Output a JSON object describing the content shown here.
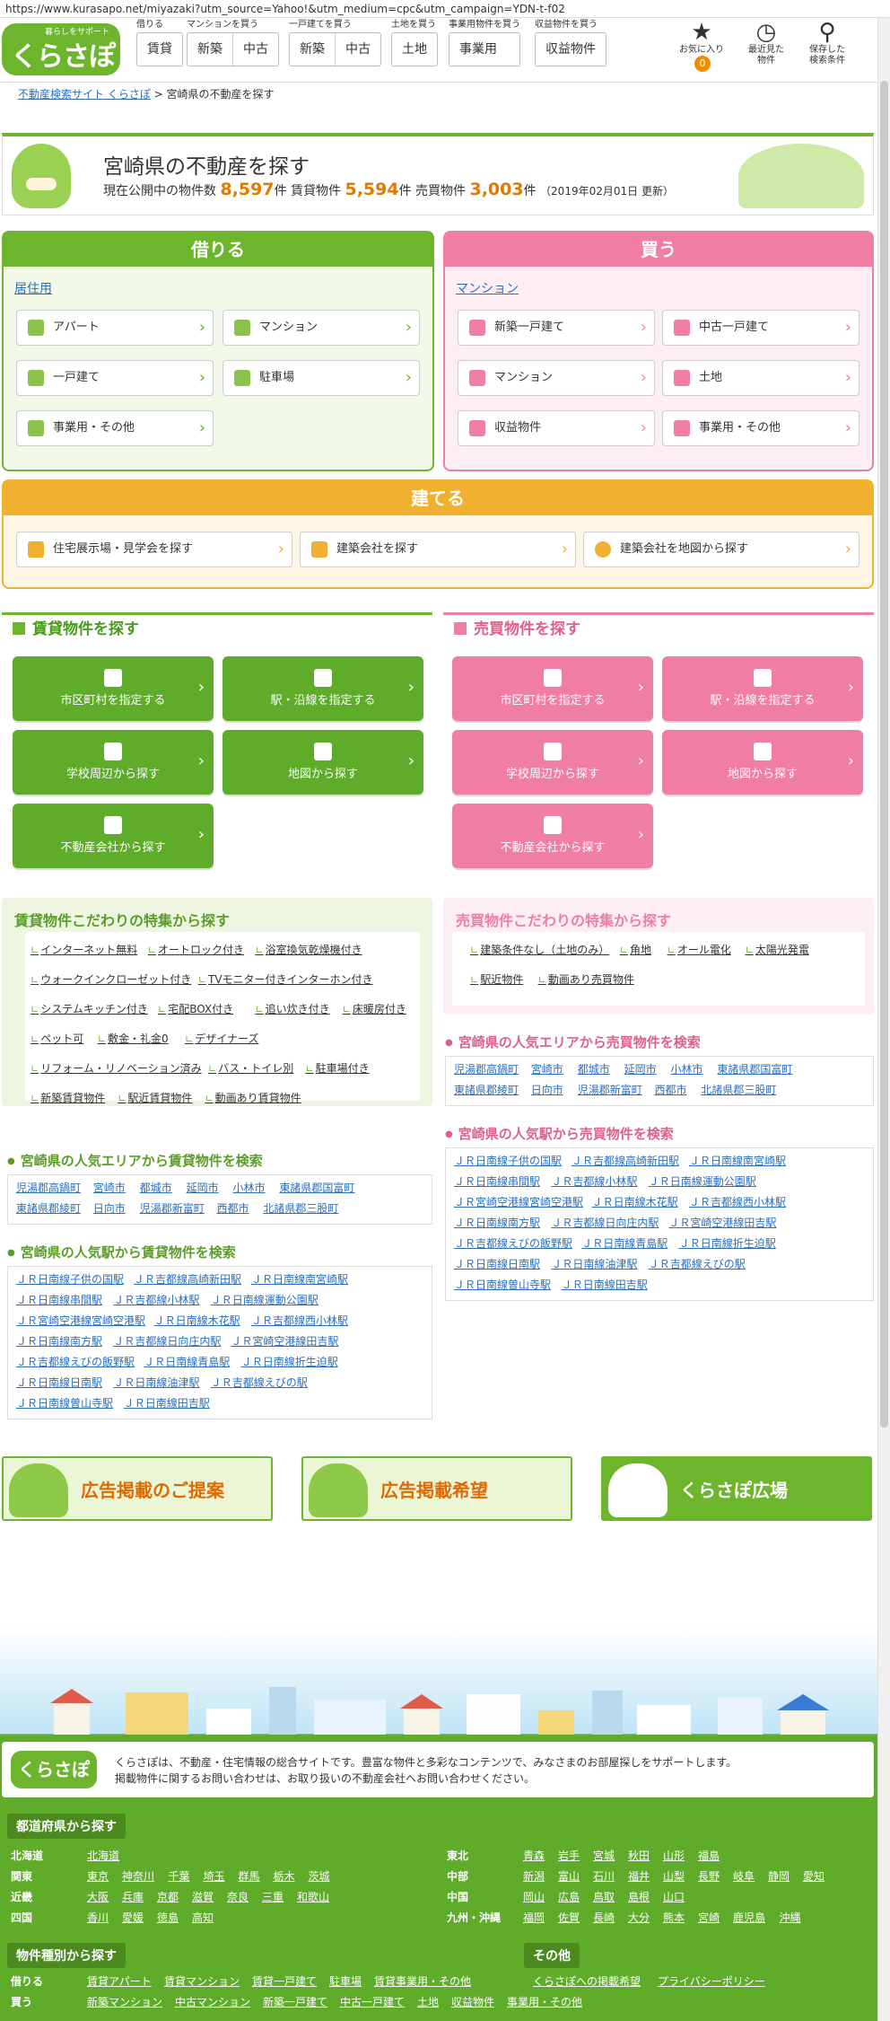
{
  "url": "https://www.kurasapo.net/miyazaki?utm_source=Yahoo!&utm_medium=cpc&utm_campaign=YDN-t-f02",
  "logo": {
    "sub": "暮らしをサポート",
    "main": "くらさぽ"
  },
  "nav": [
    {
      "cap": "借りる",
      "items": [
        "賃貸"
      ]
    },
    {
      "cap": "マンションを買う",
      "items": [
        "新築",
        "中古"
      ]
    },
    {
      "cap": "一戸建てを買う",
      "items": [
        "新築",
        "中古"
      ]
    },
    {
      "cap": "土地を買う",
      "items": [
        "土地"
      ]
    },
    {
      "cap": "事業用物件を買う",
      "items": [
        "事業用"
      ]
    },
    {
      "cap": "収益物件を買う",
      "items": [
        "収益物件"
      ]
    }
  ],
  "hicons": [
    {
      "label": "お気に入り",
      "badge": "0"
    },
    {
      "label": "最近見た\n物件"
    },
    {
      "label": "保存した\n検索条件"
    }
  ],
  "breadcrumb": {
    "home": "不動産検索サイト くらさぽ",
    "sep": ">",
    "current": "宮崎県の不動産を探す"
  },
  "hero": {
    "title": "宮崎県の不動産を探す",
    "l1": "現在公開中の物件数",
    "n1": "8,597",
    "u1": "件 賃貸物件",
    "n2": "5,594",
    "u2": "件 売買物件",
    "n3": "3,003",
    "u3": "件",
    "date": "（2019年02月01日 更新）"
  },
  "rent": {
    "title": "借りる",
    "sub": "居住用",
    "tiles": [
      "アパート",
      "マンション",
      "一戸建て",
      "駐車場",
      "事業用・その他"
    ]
  },
  "buy": {
    "title": "買う",
    "sub": "マンション",
    "tiles": [
      "新築一戸建て",
      "中古一戸建て",
      "マンション",
      "土地",
      "収益物件",
      "事業用・その他"
    ]
  },
  "build": {
    "title": "建てる",
    "tiles": [
      "住宅展示場・見学会を探す",
      "建築会社を探す",
      "建築会社を地図から探す"
    ]
  },
  "rentSearch": {
    "title": "賃貸物件を探す",
    "btns": [
      "市区町村を指定する",
      "駅・沿線を指定する",
      "学校周辺から探す",
      "地図から探す",
      "不動産会社から探す"
    ]
  },
  "buySearch": {
    "title": "売買物件を探す",
    "btns": [
      "市区町村を指定する",
      "駅・沿線を指定する",
      "学校周辺から探す",
      "地図から探す",
      "不動産会社から探す"
    ]
  },
  "rentFeat": {
    "title": "賃貸物件こだわりの特集から探す",
    "tags": [
      [
        "インターネット無料",
        "オートロック付き",
        "浴室換気乾燥機付き"
      ],
      [
        "ウォークインクローゼット付き",
        "TVモニター付きインターホン付き"
      ],
      [
        "システムキッチン付き",
        "宅配BOX付き",
        "追い炊き付き",
        "床暖房付き"
      ],
      [
        "ペット可",
        "敷金・礼金0",
        "デザイナーズ"
      ],
      [
        "リフォーム・リノベーション済み",
        "バス・トイレ別",
        "駐車場付き"
      ],
      [
        "新築賃貸物件",
        "駅近賃貸物件",
        "動画あり賃貸物件"
      ]
    ]
  },
  "buyFeat": {
    "title": "売買物件こだわりの特集から探す",
    "tags": [
      [
        "建築条件なし（土地のみ）",
        "角地",
        "オール電化",
        "太陽光発電"
      ],
      [
        "駅近物件",
        "動画あり売買物件"
      ]
    ]
  },
  "rentArea": {
    "title": "宮崎県の人気エリアから賃貸物件を検索",
    "rows": [
      [
        "児湯郡高鍋町",
        "宮崎市",
        "都城市",
        "延岡市",
        "小林市",
        "東諸県郡国富町"
      ],
      [
        "東諸県郡綾町",
        "日向市",
        "児湯郡新富町",
        "西都市",
        "北諸県郡三股町"
      ]
    ]
  },
  "buyArea": {
    "title": "宮崎県の人気エリアから売買物件を検索",
    "rows": [
      [
        "児湯郡高鍋町",
        "宮崎市",
        "都城市",
        "延岡市",
        "小林市",
        "東諸県郡国富町"
      ],
      [
        "東諸県郡綾町",
        "日向市",
        "児湯郡新富町",
        "西都市",
        "北諸県郡三股町"
      ]
    ]
  },
  "rentSta": {
    "title": "宮崎県の人気駅から賃貸物件を検索",
    "rows": [
      [
        "ＪＲ日南線子供の国駅",
        "ＪＲ吉都線高崎新田駅",
        "ＪＲ日南線南宮崎駅"
      ],
      [
        "ＪＲ日南線串間駅",
        "ＪＲ吉都線小林駅",
        "ＪＲ日南線運動公園駅"
      ],
      [
        "ＪＲ宮崎空港線宮崎空港駅",
        "ＪＲ日南線木花駅",
        "ＪＲ吉都線西小林駅"
      ],
      [
        "ＪＲ日南線南方駅",
        "ＪＲ吉都線日向庄内駅",
        "ＪＲ宮崎空港線田吉駅"
      ],
      [
        "ＪＲ吉都線えびの飯野駅",
        "ＪＲ日南線青島駅",
        "ＪＲ日南線折生迫駅"
      ],
      [
        "ＪＲ日南線日南駅",
        "ＪＲ日南線油津駅",
        "ＪＲ吉都線えびの駅"
      ],
      [
        "ＪＲ日南線曽山寺駅",
        "ＪＲ日南線田吉駅"
      ]
    ]
  },
  "buySta": {
    "title": "宮崎県の人気駅から売買物件を検索",
    "rows": [
      [
        "ＪＲ日南線子供の国駅",
        "ＪＲ吉都線高崎新田駅",
        "ＪＲ日南線南宮崎駅"
      ],
      [
        "ＪＲ日南線串間駅",
        "ＪＲ吉都線小林駅",
        "ＪＲ日南線運動公園駅"
      ],
      [
        "ＪＲ宮崎空港線宮崎空港駅",
        "ＪＲ日南線木花駅",
        "ＪＲ吉都線西小林駅"
      ],
      [
        "ＪＲ日南線南方駅",
        "ＪＲ吉都線日向庄内駅",
        "ＪＲ宮崎空港線田吉駅"
      ],
      [
        "ＪＲ吉都線えびの飯野駅",
        "ＪＲ日南線青島駅",
        "ＪＲ日南線折生迫駅"
      ],
      [
        "ＪＲ日南線日南駅",
        "ＪＲ日南線油津駅",
        "ＪＲ吉都線えびの駅"
      ],
      [
        "ＪＲ日南線曽山寺駅",
        "ＪＲ日南線田吉駅"
      ]
    ]
  },
  "banners": [
    "広告掲載のご提案",
    "広告掲載希望",
    "くらさぽ広場"
  ],
  "footer": {
    "logo": "くらさぽ",
    "t1": "くらさぽは、不動産・住宅情報の総合サイトです。豊富な物件と多彩なコンテンツで、みなさまのお部屋探しをサポートします。",
    "t2": "掲載物件に関するお問い合わせは、お取り扱いの不動産会社へお問い合わせください。",
    "prefTitle": "都道府県から探す",
    "prefL": [
      {
        "r": "北海道",
        "p": [
          "北海道"
        ]
      },
      {
        "r": "関東",
        "p": [
          "東京",
          "神奈川",
          "千葉",
          "埼玉",
          "群馬",
          "栃木",
          "茨城"
        ]
      },
      {
        "r": "近畿",
        "p": [
          "大阪",
          "兵庫",
          "京都",
          "滋賀",
          "奈良",
          "三重",
          "和歌山"
        ]
      },
      {
        "r": "四国",
        "p": [
          "香川",
          "愛媛",
          "徳島",
          "高知"
        ]
      }
    ],
    "prefR": [
      {
        "r": "東北",
        "p": [
          "青森",
          "岩手",
          "宮城",
          "秋田",
          "山形",
          "福島"
        ]
      },
      {
        "r": "中部",
        "p": [
          "新潟",
          "富山",
          "石川",
          "福井",
          "山梨",
          "長野",
          "岐阜",
          "静岡",
          "愛知"
        ]
      },
      {
        "r": "中国",
        "p": [
          "岡山",
          "広島",
          "鳥取",
          "島根",
          "山口"
        ]
      },
      {
        "r": "九州・沖縄",
        "p": [
          "福岡",
          "佐賀",
          "長崎",
          "大分",
          "熊本",
          "宮崎",
          "鹿児島",
          "沖縄"
        ]
      }
    ],
    "typeTitle": "物件種別から探す",
    "otherTitle": "その他",
    "types": [
      {
        "r": "借りる",
        "p": [
          "賃貸アパート",
          "賃貸マンション",
          "賃貸一戸建て",
          "駐車場",
          "賃貸事業用・その他"
        ]
      },
      {
        "r": "買う",
        "p": [
          "新築マンション",
          "中古マンション",
          "新築一戸建て",
          "中古一戸建て",
          "土地",
          "収益物件",
          "事業用・その他"
        ]
      }
    ],
    "others": [
      "くらさぽへの掲載希望",
      "プライバシーポリシー"
    ]
  },
  "colors": {
    "green": "#6cb52d",
    "pink": "#ef7ea2",
    "orange": "#f0b030"
  }
}
